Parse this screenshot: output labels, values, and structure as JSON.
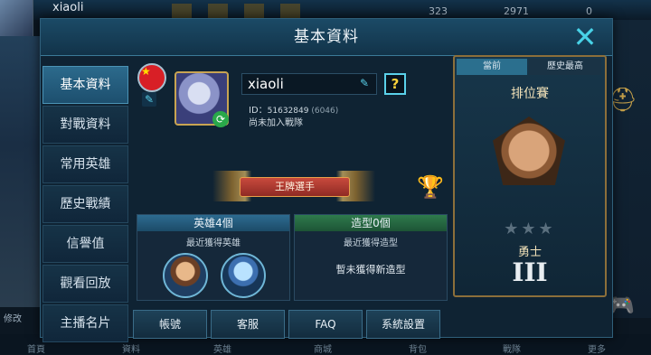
{
  "background": {
    "username": "xiaoli",
    "stats": [
      "323",
      "2971",
      "0"
    ],
    "left_label": "修改",
    "bottom_tabs": [
      "首頁",
      "資料",
      "英雄",
      "商城",
      "背包",
      "戰隊",
      "更多"
    ]
  },
  "dialog": {
    "title": "基本資料",
    "close_symbol": "✕"
  },
  "nav": {
    "items": [
      "基本資料",
      "對戰資料",
      "常用英雄",
      "歷史戰績",
      "信譽值",
      "觀看回放",
      "主播名片"
    ],
    "active_index": 0
  },
  "profile": {
    "name": "xiaoli",
    "help_symbol": "?",
    "id_label": "ID：",
    "id_value": "51632849",
    "id_extra": "(6046)",
    "team_status": "尚未加入戰隊",
    "rank_title": "王牌選手"
  },
  "heroes_card": {
    "title": "英雄4個",
    "subtitle": "最近獲得英雄"
  },
  "skins_card": {
    "title": "造型0個",
    "subtitle": "最近獲得造型",
    "empty_text": "暫未獲得新造型"
  },
  "footer": {
    "account": "帳號",
    "support": "客服",
    "faq": "FAQ",
    "settings": "系統設置"
  },
  "rank": {
    "tab_current": "當前",
    "tab_highest": "歷史最高",
    "mode": "排位賽",
    "stars_filled": 0,
    "stars_total": 3,
    "stars_display": "★★★",
    "tier_name": "勇士",
    "division": "III"
  },
  "colors": {
    "accent_cyan": "#48d1e6",
    "gold": "#c8a452",
    "heroes_header": "#2d6b90",
    "skins_header": "#2e7a4c"
  }
}
